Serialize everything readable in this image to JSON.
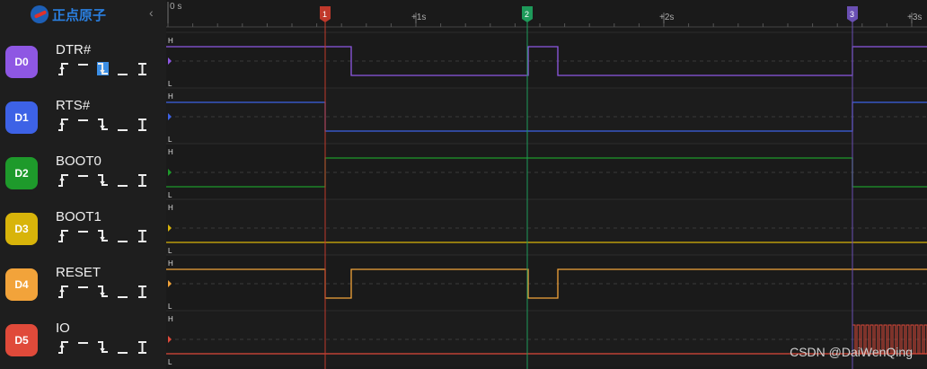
{
  "logo": {
    "text": "正点原子"
  },
  "timeline": {
    "ticks": [
      "0 s",
      "+1s",
      "+2s",
      "+3s"
    ]
  },
  "markers": [
    "1",
    "2",
    "3"
  ],
  "channels": [
    {
      "id": "D0",
      "name": "DTR#",
      "color": "#8e57e3",
      "selected_trigger": 2
    },
    {
      "id": "D1",
      "name": "RTS#",
      "color": "#3d62e6",
      "selected_trigger": -1
    },
    {
      "id": "D2",
      "name": "BOOT0",
      "color": "#1e9a2b",
      "selected_trigger": -1
    },
    {
      "id": "D3",
      "name": "BOOT1",
      "color": "#d8b40a",
      "selected_trigger": -1
    },
    {
      "id": "D4",
      "name": "RESET",
      "color": "#f2a33a",
      "selected_trigger": -1
    },
    {
      "id": "D5",
      "name": "IO",
      "color": "#e04a3a",
      "selected_trigger": -1
    }
  ],
  "level_labels": {
    "high": "H",
    "low": "L"
  },
  "watermark": "CSDN @DaiWenQing"
}
